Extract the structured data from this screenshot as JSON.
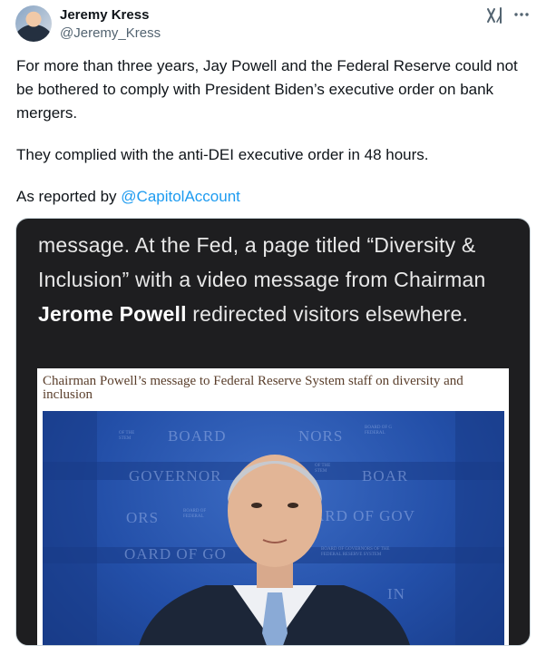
{
  "author": {
    "name": "Jeremy Kress",
    "handle": "@Jeremy_Kress"
  },
  "icons": {
    "grok": "grok-icon",
    "more": "more-icon"
  },
  "tweet": {
    "paragraph1": "For more than three years, Jay Powell and the Federal Reserve could not be bothered to comply with President Biden’s executive order on bank mergers.",
    "paragraph2": "They complied with the anti-DEI executive order in 48 hours.",
    "reported_prefix": "As reported by ",
    "mention": "@CapitolAccount"
  },
  "media": {
    "article_line1": "message. At the Fed, a page titled “Diversity &",
    "article_line2": "Inclusion” with a video message from Chairman",
    "article_bold": "Jerome Powell",
    "article_line3_rest": " redirected visitors elsewhere.",
    "screenshot_title": "Chairman Powell’s message to Federal Reserve System staff on diversity and inclusion"
  },
  "colors": {
    "link": "#1d9bf0",
    "text": "#0f1419",
    "muted": "#536471",
    "media_bg": "#1e1e20",
    "video_blue": "#234fa8"
  }
}
